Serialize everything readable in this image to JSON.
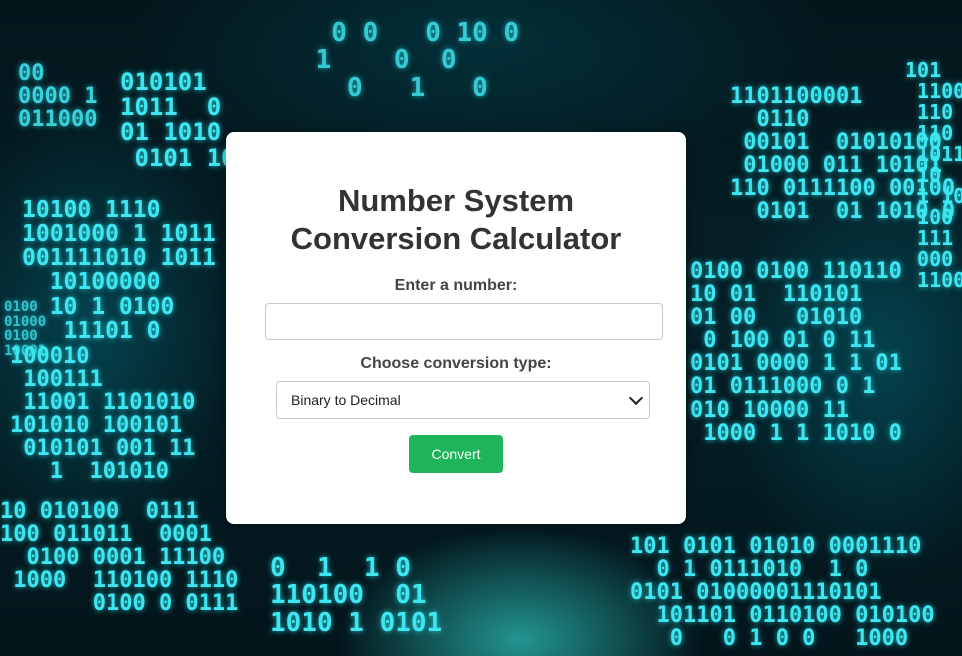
{
  "calculator": {
    "title_line1": "Number System",
    "title_line2": "Conversion Calculator",
    "number_label": "Enter a number:",
    "number_value": "",
    "number_placeholder": "",
    "conversion_label": "Choose conversion type:",
    "conversion_selected": "Binary to Decimal",
    "convert_button": "Convert"
  },
  "background": {
    "theme": "binary code wallpaper",
    "accent_color": "#3fe6f0",
    "button_color": "#1fb35c"
  }
}
